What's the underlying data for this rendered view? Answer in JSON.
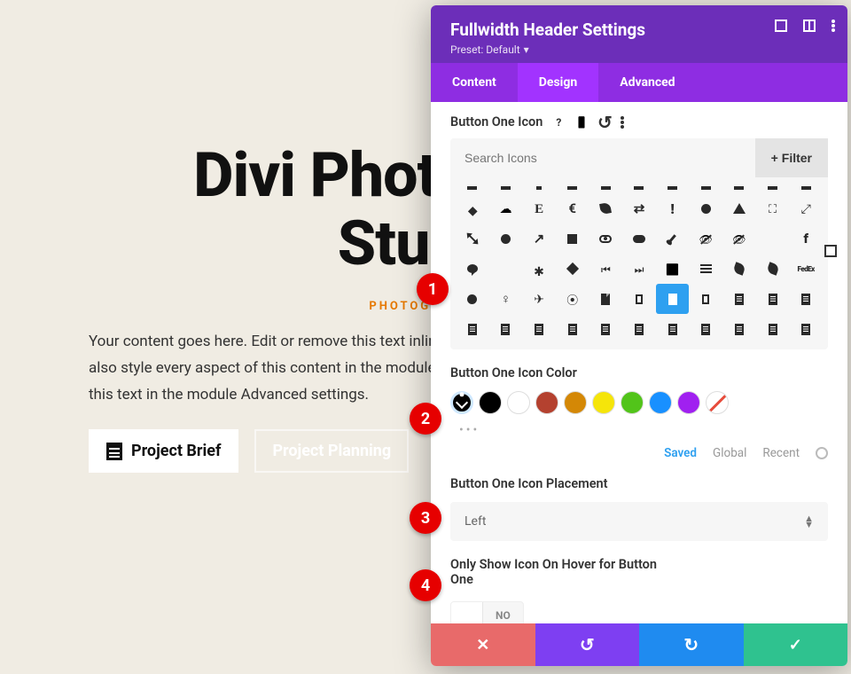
{
  "page": {
    "heading_line1": "Divi Photography",
    "heading_line2": "Studio",
    "subheading": "PHOTOGRAPHY",
    "body": "Your content goes here. Edit or remove this text inline or in the module Content settings. You can also style every aspect of this content in the module Design settings and even apply custom CSS to this text in the module Advanced settings.",
    "button_primary": "Project Brief",
    "button_secondary": "Project Planning"
  },
  "panel": {
    "title": "Fullwidth Header Settings",
    "preset_label": "Preset: Default",
    "tabs": {
      "content": "Content",
      "design": "Design",
      "advanced": "Advanced",
      "active": "design"
    },
    "button_one_icon": {
      "label": "Button One Icon",
      "search_placeholder": "Search Icons",
      "filter_label": "Filter",
      "selected_row": 4,
      "selected_col": 6
    },
    "icon_color": {
      "label": "Button One Icon Color",
      "palette": [
        "picker",
        "#000000",
        "#ffffff",
        "#b4412f",
        "#d48806",
        "#f5e50a",
        "#52c41a",
        "#1890ff",
        "#a020f0",
        "stripe"
      ],
      "tabs": {
        "saved": "Saved",
        "global": "Global",
        "recent": "Recent",
        "active": "saved"
      }
    },
    "icon_placement": {
      "label": "Button One Icon Placement",
      "value": "Left"
    },
    "only_hover": {
      "label": "Only Show Icon On Hover for Button One",
      "value": "NO"
    }
  },
  "callouts": [
    "1",
    "2",
    "3",
    "4"
  ]
}
